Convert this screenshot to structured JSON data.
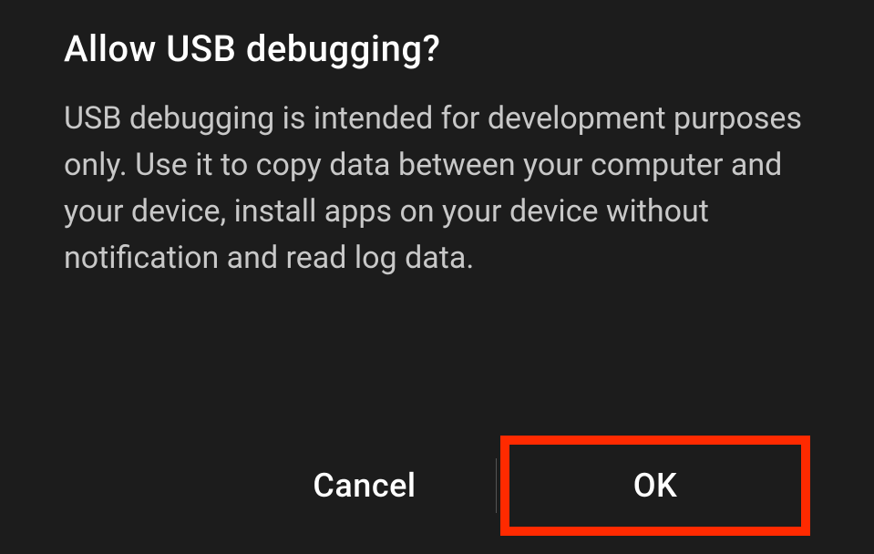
{
  "dialog": {
    "title": "Allow USB debugging?",
    "body": "USB debugging is intended for development purposes only. Use it to copy data between your computer and your device, install apps on your device without notification and read log data.",
    "buttons": {
      "cancel": "Cancel",
      "ok": "OK"
    }
  },
  "annotation": {
    "highlight_color": "#ff2a00",
    "highlighted_button": "ok"
  }
}
